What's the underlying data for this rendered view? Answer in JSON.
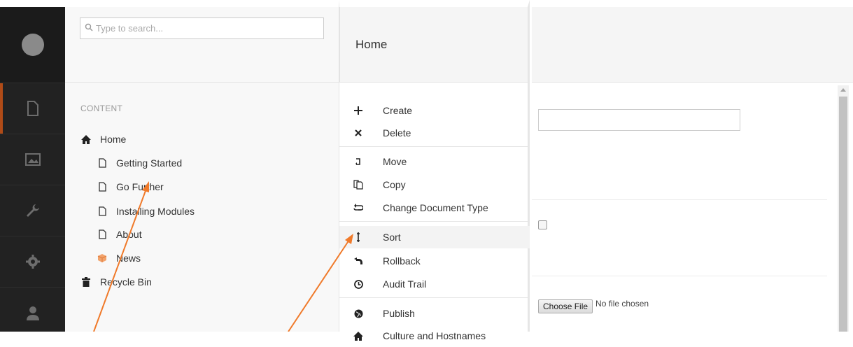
{
  "search": {
    "placeholder": "Type to search..."
  },
  "tree": {
    "section_label": "CONTENT",
    "root": {
      "label": "Home",
      "icon": "home-icon"
    },
    "children": [
      {
        "label": "Getting Started",
        "icon": "document-icon"
      },
      {
        "label": "Go Further",
        "icon": "document-icon"
      },
      {
        "label": "Installing Modules",
        "icon": "document-icon"
      },
      {
        "label": "About",
        "icon": "document-icon"
      },
      {
        "label": "News",
        "icon": "box-icon"
      }
    ],
    "recycle_bin": {
      "label": "Recycle Bin",
      "icon": "trash-icon"
    }
  },
  "menu": {
    "title": "Home",
    "items": [
      {
        "label": "Create",
        "icon": "plus-icon"
      },
      {
        "label": "Delete",
        "icon": "x-icon"
      },
      {
        "label": "Move",
        "icon": "move-icon"
      },
      {
        "label": "Copy",
        "icon": "copy-icon"
      },
      {
        "label": "Change Document Type",
        "icon": "swap-icon"
      },
      {
        "label": "Sort",
        "icon": "sort-icon"
      },
      {
        "label": "Rollback",
        "icon": "undo-icon"
      },
      {
        "label": "Audit Trail",
        "icon": "clock-icon"
      },
      {
        "label": "Publish",
        "icon": "globe-icon"
      },
      {
        "label": "Culture and Hostnames",
        "icon": "home-icon"
      }
    ]
  },
  "editor": {
    "file_button": "Choose File",
    "file_status": "No file chosen"
  },
  "colors": {
    "rail_bg": "#222222",
    "active_accent": "#b04b17",
    "annotation_arrow": "#f07a2a"
  }
}
